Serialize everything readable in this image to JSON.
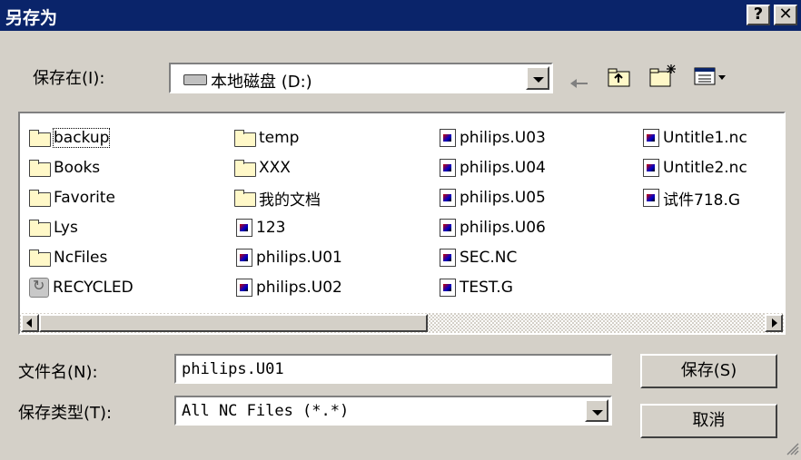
{
  "window": {
    "title": "另存为"
  },
  "title_buttons": {
    "help": "?",
    "close": "✕"
  },
  "save_in": {
    "label": "保存在(I):",
    "value": "本地磁盘 (D:)"
  },
  "toolbar": [
    "back-icon",
    "up-folder-icon",
    "new-folder-icon",
    "view-menu-icon"
  ],
  "files": {
    "col1": [
      "backup",
      "Books",
      "Favorite",
      "Lys",
      "NcFiles",
      "RECYCLED"
    ],
    "col2": [
      "temp",
      "XXX",
      "我的文档",
      "123",
      "philips.U01",
      "philips.U02"
    ],
    "col3": [
      "philips.U03",
      "philips.U04",
      "philips.U05",
      "philips.U06",
      "SEC.NC",
      "TEST.G"
    ],
    "col4": [
      "Untitle1.nc",
      "Untitle2.nc",
      "试件718.G"
    ]
  },
  "filename": {
    "label": "文件名(N):",
    "value": "philips.U01"
  },
  "filetype": {
    "label": "保存类型(T):",
    "value": "All NC Files (*.*)"
  },
  "buttons": {
    "save": "保存(S)",
    "cancel": "取消"
  }
}
